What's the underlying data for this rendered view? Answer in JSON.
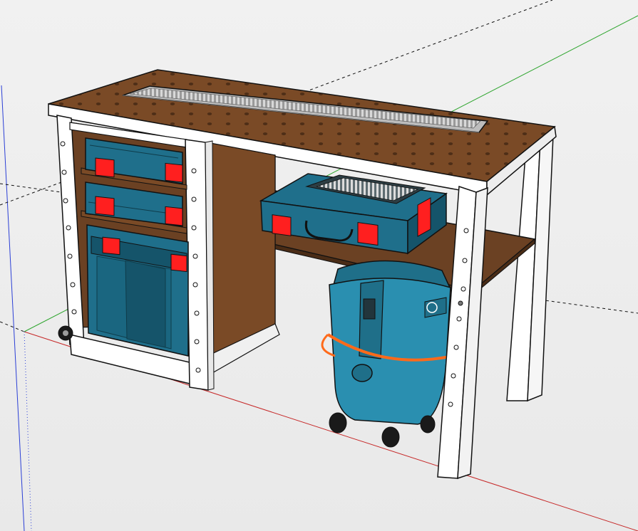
{
  "scene": {
    "background": "#ececec",
    "axes": {
      "red_axis_color": "#c62828",
      "green_axis_color": "#2ea52e",
      "blue_axis_color": "#2b3fd6"
    },
    "materials": {
      "frame_color": "#ffffff",
      "frame_outline": "#111111",
      "plywood_top_color": "#7a4a26",
      "plywood_side_color": "#6b4123",
      "case_color": "#1f6f8b",
      "case_dark_color": "#15546a",
      "latch_color": "#ff1f1f",
      "vacuum_color": "#2a8fb0",
      "vacuum_dark_color": "#1f6f89",
      "hose_band_color": "#ff6a1a"
    },
    "objects": [
      {
        "name": "workbench-top",
        "icon": "pegboard-top"
      },
      {
        "name": "guide-rail",
        "icon": "aluminium-rail"
      },
      {
        "name": "left-cabinet",
        "icon": "shelf-unit"
      },
      {
        "name": "system-case-top",
        "icon": "toolbox"
      },
      {
        "name": "system-case-middle",
        "icon": "toolbox"
      },
      {
        "name": "system-case-bottom",
        "icon": "toolbox"
      },
      {
        "name": "middle-shelf",
        "icon": "shelf"
      },
      {
        "name": "bit-case-open",
        "icon": "toolbox"
      },
      {
        "name": "dust-extractor",
        "icon": "vacuum"
      }
    ]
  }
}
